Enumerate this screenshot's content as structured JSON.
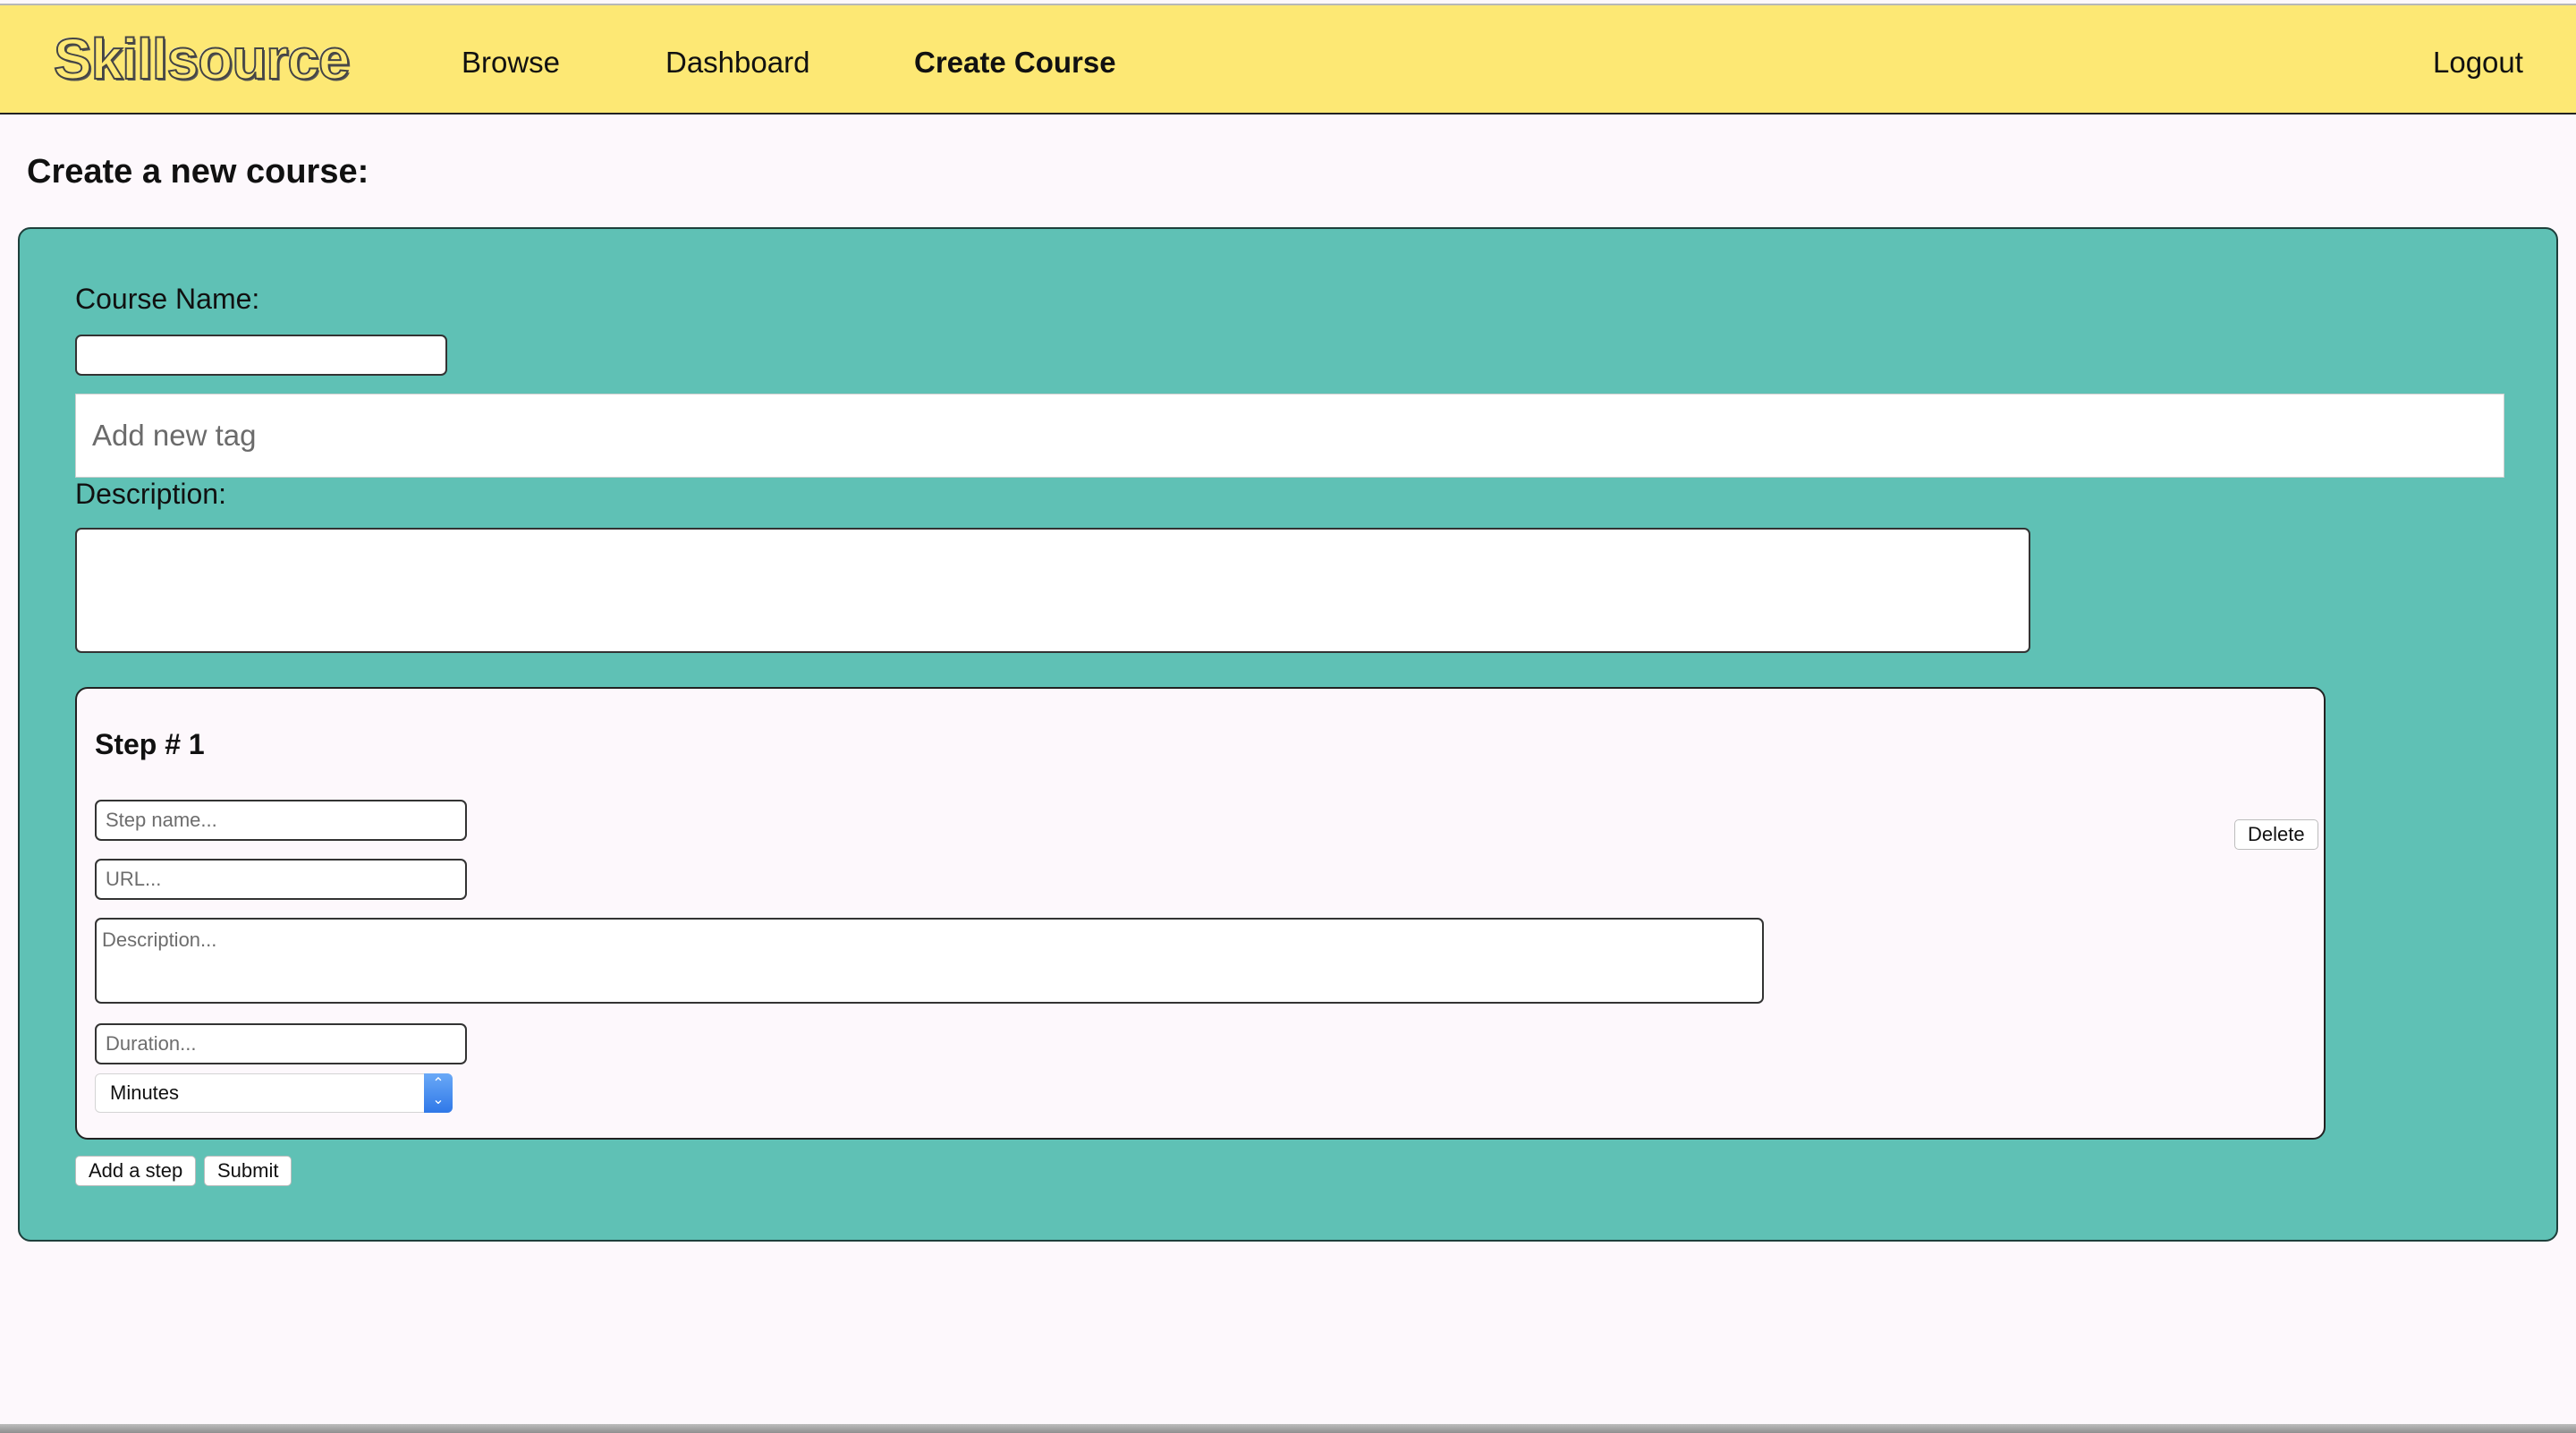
{
  "nav": {
    "brand": "Skillsource",
    "links": [
      "Browse",
      "Dashboard",
      "Create Course"
    ],
    "active": "Create Course",
    "logout": "Logout"
  },
  "page": {
    "heading": "Create a new course:"
  },
  "form": {
    "course_name_label": "Course Name:",
    "course_name_value": "",
    "tag_placeholder": "Add new tag",
    "description_label": "Description:",
    "description_value": "",
    "steps": [
      {
        "title": "Step # 1",
        "name_placeholder": "Step name...",
        "url_placeholder": "URL...",
        "description_placeholder": "Description...",
        "duration_placeholder": "Duration...",
        "unit_selected": "Minutes",
        "delete_label": "Delete"
      }
    ],
    "add_step_label": "Add a step",
    "submit_label": "Submit"
  },
  "colors": {
    "navbar": "#fde874",
    "panel": "#5fc1b5",
    "page_background": "#fdf8fc",
    "select_accent": "#2f78e8"
  },
  "icons": {
    "select_arrows": "chevron-up-down-icon"
  }
}
